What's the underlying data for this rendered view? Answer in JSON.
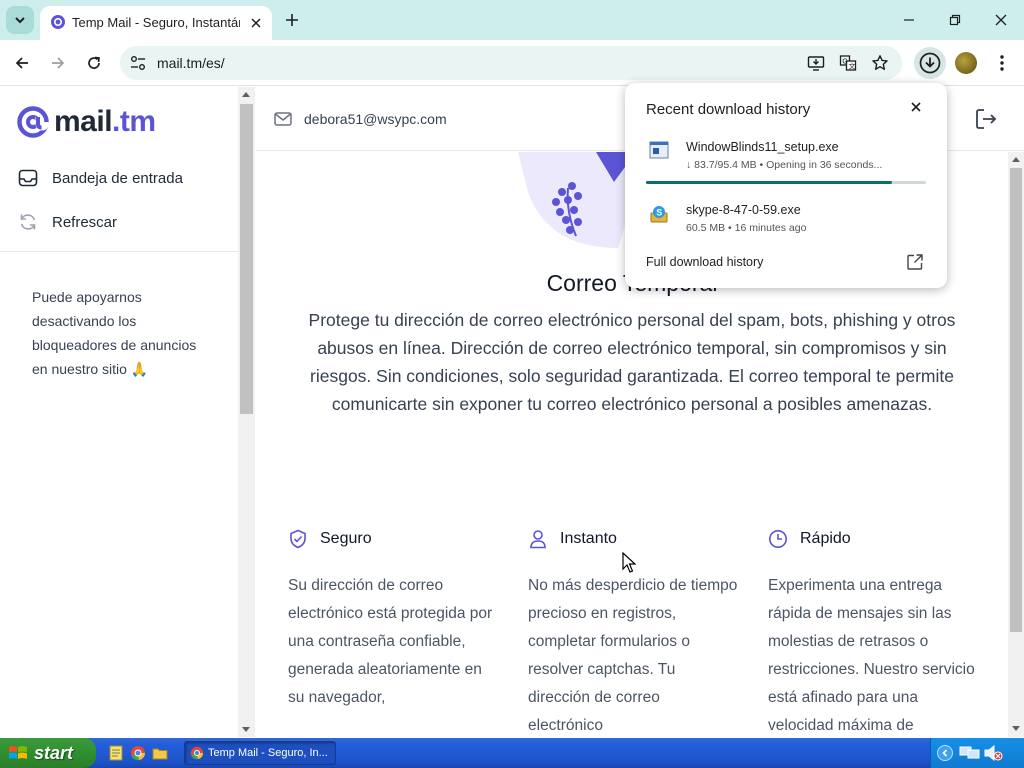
{
  "browser": {
    "tab_title": "Temp Mail - Seguro, Instantáneo",
    "url": "mail.tm/es/"
  },
  "sidebar": {
    "logo_at": "@",
    "logo_mail": "mail",
    "logo_tm": ".tm",
    "items": [
      {
        "label": "Bandeja de entrada",
        "icon": "inbox-icon"
      },
      {
        "label": "Refrescar",
        "icon": "refresh-icon"
      }
    ],
    "support_text": "Puede apoyarnos desactivando los bloqueadores de anuncios en nuestro sitio 🙏"
  },
  "header": {
    "email": "debora51@wsypc.com"
  },
  "hero": {
    "title": "Correo Temporal",
    "description": "Protege tu dirección de correo electrónico personal del spam, bots, phishing y otros abusos en línea. Dirección de correo electrónico temporal, sin compromisos y sin riesgos. Sin condiciones, solo seguridad garantizada. El correo temporal te permite comunicarte sin exponer tu correo electrónico personal a posibles amenazas."
  },
  "features": [
    {
      "title": "Seguro",
      "icon": "shield-check-icon",
      "body": "Su dirección de correo electrónico está protegida por una contraseña confiable, generada aleatoriamente en su navegador,"
    },
    {
      "title": "Instanto",
      "icon": "user-icon",
      "body": "No más desperdicio de tiempo precioso en registros, completar formularios o resolver captchas. Tu dirección de correo electrónico"
    },
    {
      "title": "Rápido",
      "icon": "clock-icon",
      "body": "Experimenta una entrega rápida de mensajes sin las molestias de retrasos o restricciones. Nuestro servicio está afinado para una velocidad máxima de"
    }
  ],
  "downloads": {
    "title": "Recent download history",
    "items": [
      {
        "name": "WindowBlinds11_setup.exe",
        "status": "↓ 83.7/95.4 MB • Opening in 36 seconds...",
        "progress": 0.877,
        "icon": "installer-icon"
      },
      {
        "name": "skype-8-47-0-59.exe",
        "status": "60.5 MB • 16 minutes ago",
        "icon": "skype-installer-icon"
      }
    ],
    "full_history": "Full download history"
  },
  "taskbar": {
    "start_label": "start",
    "task_label": "Temp Mail - Seguro, In..."
  },
  "colors": {
    "brand": "#5b55d6",
    "tab_strip": "#cdeeec",
    "progress": "#0b6e6a"
  }
}
